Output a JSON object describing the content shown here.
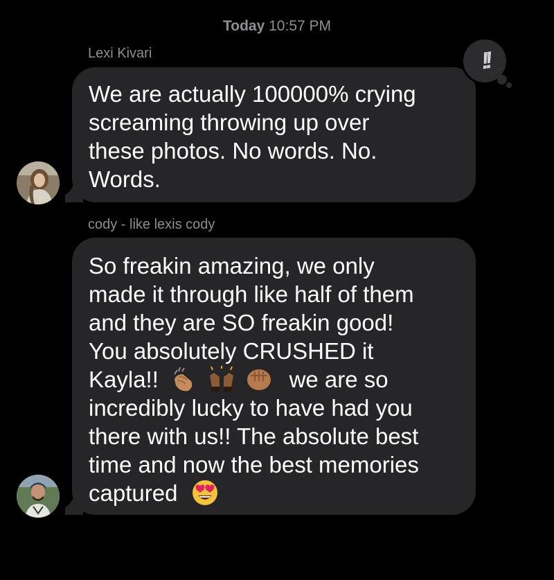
{
  "header": {
    "timestamp_day": "Today",
    "timestamp_time": "10:57 PM"
  },
  "messages": [
    {
      "sender": "Lexi Kivari",
      "lines": [
        "We are actually 100000% crying",
        "screaming throwing up over",
        "these photos. No words. No.",
        "Words."
      ],
      "reaction_icon": "double-exclamation-tapback-icon",
      "reaction_text": "!!"
    },
    {
      "sender": "cody - like lexis cody",
      "lines": [
        "So freakin amazing, we only",
        "made it through like half of them",
        "and they are SO freakin good!",
        "You absolutely CRUSHED it",
        "Kayla!!",
        "we are so",
        "incredibly lucky to have had you",
        "there with us!! The absolute best",
        "time and now the best memories",
        "captured"
      ],
      "emojis": [
        "clapping-hands-emoji",
        "raising-hands-emoji",
        "fist-bump-emoji",
        "heart-eyes-emoji"
      ]
    }
  ],
  "colors": {
    "background": "#000000",
    "bubble": "#262628",
    "secondary_text": "#8e8e93",
    "primary_text": "#ffffff",
    "skin_tone": "#c58c5c",
    "emoji_yellow": "#f5c33b",
    "heart_red": "#e0245e"
  }
}
